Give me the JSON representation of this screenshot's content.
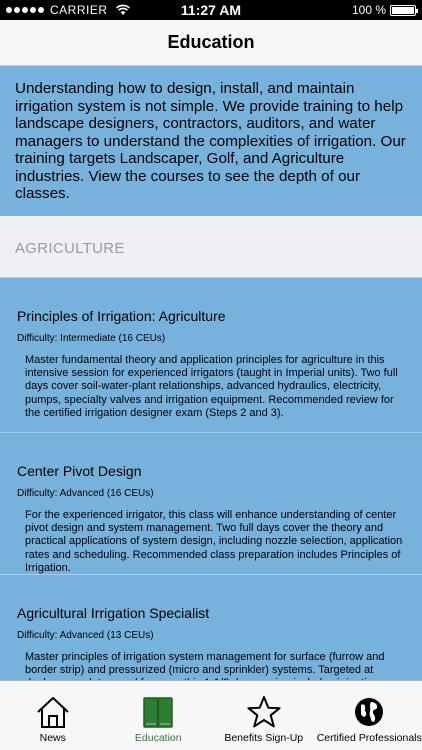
{
  "status_bar": {
    "carrier": "CARRIER",
    "time": "11:27 AM",
    "battery": "100 %"
  },
  "nav": {
    "title": "Education"
  },
  "intro": {
    "text": "Understanding how to design, install, and maintain irrigation system is not simple. We provide training to help landscape designers, contractors, auditors, and water managers to understand the complexities of irrigation. Our training targets Landscaper, Golf, and Agriculture industries. View the courses to see the depth of our classes."
  },
  "section": {
    "title": "AGRICULTURE"
  },
  "courses": [
    {
      "name": "Principles of Irrigation: Agriculture",
      "difficulty": "Difficulty: Intermediate (16 CEUs)",
      "description": "Master fundamental theory and application principles for agriculture in this intensive session for experienced irrigators (taught in Imperial units). Two full days cover soil-water-plant relationships, advanced hydraulics, electricity, pumps, specialty valves and irrigation equipment. Recommended review for the certified irrigation designer exam (Steps 2 and 3)."
    },
    {
      "name": "Center Pivot Design",
      "difficulty": "Difficulty: Advanced (16 CEUs)",
      "description": "For the experienced irrigator, this class will enhance understanding of center pivot design and system management. Two full days cover the theory and practical applications of system design, including nozzle selection, application rates and scheduling. Recommended class preparation includes Principles of Irrigation."
    },
    {
      "name": "Agricultural Irrigation Specialist",
      "difficulty": "Difficulty: Advanced (13 CEUs)",
      "description": "Master principles of irrigation system management for surface (furrow and border strip) and pressurized (micro and sprinkler) systems. Targeted at dealers, regulators and farmers, this 1-1/2 day session includes irrigation volume and frequency, evapotranspiration and crop coefficients, scheduling and system maintenance. Recommended review for the certified agricultural irrigation specialist exam."
    }
  ],
  "tabs": [
    {
      "label": "News",
      "icon": "house-icon",
      "active": false
    },
    {
      "label": "Education",
      "icon": "book-icon",
      "active": true
    },
    {
      "label": "Benefits Sign-Up",
      "icon": "star-icon",
      "active": false
    },
    {
      "label": "Certified Professionals",
      "icon": "globe-icon",
      "active": false
    }
  ],
  "colors": {
    "accent_blue": "#77b2dd",
    "active_tab": "#2e7d32"
  }
}
